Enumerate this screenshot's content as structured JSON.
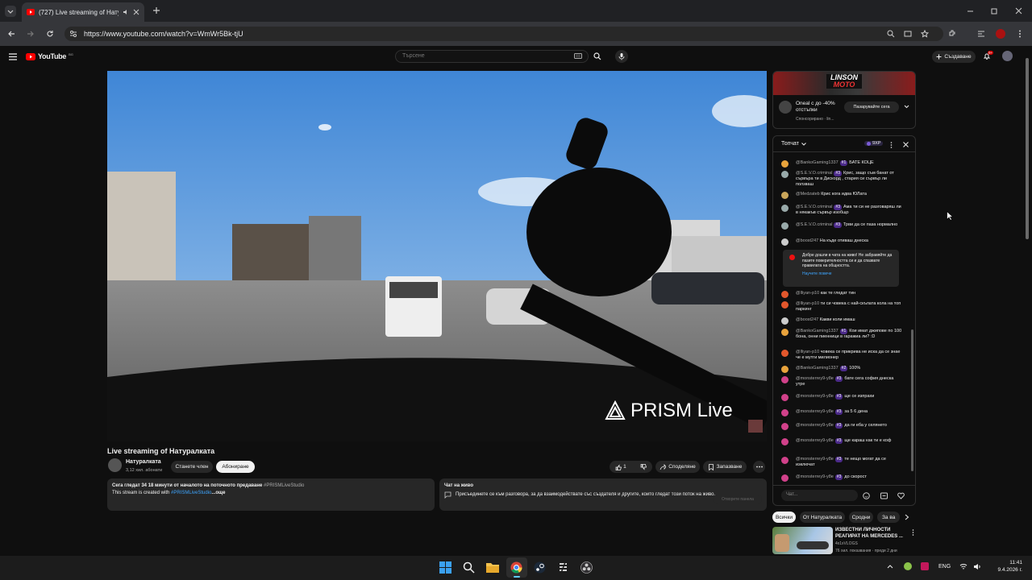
{
  "browser": {
    "tab_title": "(727) Live streaming of Натуралката",
    "url": "https://www.youtube.com/watch?v=WmWr5Bk-tjU"
  },
  "youtube": {
    "logo": "YouTube",
    "region": "BG",
    "search_placeholder": "Търсене",
    "create_label": "Създаване",
    "notif_count": "9+"
  },
  "video": {
    "watermark": "PRISM Live",
    "title": "Live streaming of Натуралката",
    "channel": "Натуралката",
    "subscribers": "3,12 хил. абонати",
    "join_label": "Станете член",
    "subscribe_label": "Абониране",
    "like_count": "1",
    "share_label": "Споделяне",
    "save_label": "Запазване",
    "desc_line1": "Сега гледат 34  18 минути от началото на поточното предаване",
    "desc_tag": "#PRISMLiveStudio",
    "desc_line2": "This stream is created with",
    "desc_link": "#PRISMLiveStudio",
    "desc_more": "...още",
    "live_chat_title": "Чат на живо",
    "live_chat_text": "Присъединете се към разговора, за да взаимодействате със създателя и другите, които гледат този поток на живо.",
    "live_chat_button": "Отворете панела"
  },
  "ad": {
    "brand1": "LINSON",
    "brand2": "MOTO",
    "text": "Oneal с до -40% отстъпки",
    "sponsor": "Спонсорирано · lin...",
    "cta": "Пазарувайте сега"
  },
  "chat": {
    "header": "Топчат",
    "points": "9XP",
    "input_placeholder": "Чат...",
    "pinned_text": "Добре дошли в чата на живо! Не забравяйте да пазите поверителността си и да спазвате правилата на общността.",
    "pinned_link": "Научете повече",
    "messages": [
      {
        "author": "@BankoGaming1337",
        "badge": "#1",
        "text": "БАТЕ КОЦЕ",
        "color": "#e8a33c"
      },
      {
        "author": "@S.E.V.O.criminal",
        "badge": "#3",
        "text": "Крис, защо съм банат от сървъра ти в Дискорд , стария си сървър ли ползваш",
        "color": "#9aa"
      },
      {
        "author": "@Medzateb",
        "badge": "",
        "text": "Крис кога идва ЮЛата",
        "color": "#c9a55a"
      },
      {
        "author": "@S.E.V.O.criminal",
        "badge": "#3",
        "text": "Ама ти си не разговаряш ли в някакъв сървър изобщо",
        "color": "#9aa"
      },
      {
        "author": "@S.E.V.O.criminal",
        "badge": "#3",
        "text": "Трви да се паза нормално",
        "color": "#9aa"
      },
      {
        "author": "@boost247",
        "badge": "",
        "text": "На къде отиваш днеска",
        "color": "#ccc"
      },
      {
        "author": "@lliyan-p10",
        "badge": "",
        "text": "как те гледат тин",
        "color": "#e2572c"
      },
      {
        "author": "@lliyan-p10",
        "badge": "",
        "text": "ти си човека с най-скъпата кола на топ паркинг",
        "color": "#e2572c"
      },
      {
        "author": "@boost247",
        "badge": "",
        "text": "Какви коли имаш",
        "color": "#ccc"
      },
      {
        "author": "@BankoGaming1337",
        "badge": "#1",
        "text": "Кои имат джипове по 100 бона, онни пиенници в гаражиа ли? :D",
        "color": "#e8a33c"
      },
      {
        "author": "@lliyan-p10",
        "badge": "",
        "text": "човека се прикрива не иска да се знае че е мутги милионер",
        "color": "#e2572c"
      },
      {
        "author": "@BankoGaming1337",
        "badge": "#2",
        "text": "100%",
        "color": "#e8a33c"
      },
      {
        "author": "@monsterrey9-y8e",
        "badge": "#3",
        "text": "бате сега софия днеска утре",
        "color": "#d1418a"
      },
      {
        "author": "@monsterrey9-y8e",
        "badge": "#3",
        "text": "ще се изпрахи",
        "color": "#d1418a"
      },
      {
        "author": "@monsterrey9-y8e",
        "badge": "#3",
        "text": "за 5 6 дена",
        "color": "#d1418a"
      },
      {
        "author": "@monsterrey9-y8e",
        "badge": "#3",
        "text": "да ги еба у селянето",
        "color": "#d1418a"
      },
      {
        "author": "@monsterrey9-y8e",
        "badge": "#3",
        "text": "ще караш как ти е коф",
        "color": "#d1418a"
      },
      {
        "author": "@monsterrey9-y8e",
        "badge": "#3",
        "text": "те нещо могат да се изключат",
        "color": "#d1418a"
      },
      {
        "author": "@monsterrey9-y8e",
        "badge": "#3",
        "text": "до скорост",
        "color": "#d1418a"
      }
    ]
  },
  "filters": [
    "Всички",
    "От Натуралката",
    "Сродни",
    "За ва"
  ],
  "recommendation": {
    "title": "ИЗВЕСТНИ ЛИЧНОСТИ РЕАГИРАТ НА MERCEDES ...",
    "channel": "4x1xVLOGS",
    "meta": "76 хил. показвания · преди 2 дни"
  },
  "taskbar": {
    "lang": "ENG",
    "time": "11:41",
    "date": "9.4.2026 г."
  }
}
